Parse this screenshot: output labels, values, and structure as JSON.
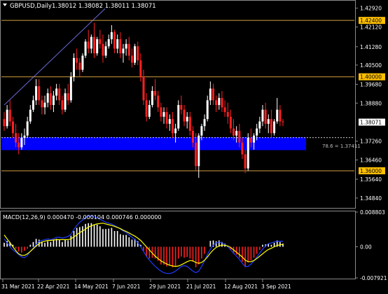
{
  "header": {
    "symbol_text": "GBPUSD,Daily",
    "ohlc_text": "1.38012 1.38082 1.38011 1.38071"
  },
  "colors": {
    "background": "#000000",
    "border": "#8a8a8a",
    "grid": "#2b2b2b",
    "axis_text": "#ffffff",
    "bull": "#ffffff",
    "bear": "#ff2020",
    "level_line": "#d4a040",
    "level_tag_bg": "#ffc000",
    "current_tag_bg": "#ffffff",
    "zone": "#0000ff",
    "trendline": "#6a6ad8",
    "fib_line": "#cccccc",
    "macd_hist_up": "#ffffff",
    "macd_hist_down": "#ff2020",
    "macd_signal": "#ffff00",
    "macd_line": "#1e3cff"
  },
  "price_axis": {
    "ticks": [
      "1.42920",
      "1.42120",
      "1.41280",
      "1.40500",
      "1.39680",
      "1.38880",
      "1.37260",
      "1.36460",
      "1.35640",
      "1.34840"
    ]
  },
  "levels": [
    {
      "value": "1.42400"
    },
    {
      "value": "1.40000"
    },
    {
      "value": "1.36000"
    }
  ],
  "current_price": "1.38071",
  "fib_label": "78.6 = 1.37411",
  "indicator": {
    "title": "MACD(12,26,9) 0.000470 -0.000104 0.000746 0.000000",
    "ticks": [
      "0.008803",
      "0.00",
      "-0.007921"
    ]
  },
  "time_axis": {
    "labels": [
      "31 Mar 2021",
      "22 Apr 2021",
      "14 May 2021",
      "7 Jun 2021",
      "29 Jun 2021",
      "21 Jul 2021",
      "12 Aug 2021",
      "3 Sep 2021"
    ]
  },
  "chart_data": {
    "type": "candlestick",
    "symbol": "GBPUSD",
    "timeframe": "Daily",
    "y_range": [
      1.3445,
      1.4315
    ],
    "candles": [
      [
        1.382,
        1.385,
        1.377,
        1.379
      ],
      [
        1.379,
        1.388,
        1.378,
        1.386
      ],
      [
        1.386,
        1.39,
        1.379,
        1.381
      ],
      [
        1.381,
        1.383,
        1.374,
        1.376
      ],
      [
        1.376,
        1.38,
        1.37,
        1.372
      ],
      [
        1.372,
        1.376,
        1.367,
        1.37
      ],
      [
        1.37,
        1.376,
        1.369,
        1.374
      ],
      [
        1.374,
        1.378,
        1.371,
        1.375
      ],
      [
        1.375,
        1.383,
        1.374,
        1.381
      ],
      [
        1.381,
        1.388,
        1.38,
        1.386
      ],
      [
        1.386,
        1.392,
        1.385,
        1.39
      ],
      [
        1.39,
        1.399,
        1.388,
        1.396
      ],
      [
        1.396,
        1.399,
        1.388,
        1.39
      ],
      [
        1.39,
        1.392,
        1.384,
        1.387
      ],
      [
        1.387,
        1.392,
        1.384,
        1.389
      ],
      [
        1.389,
        1.395,
        1.387,
        1.393
      ],
      [
        1.393,
        1.396,
        1.386,
        1.388
      ],
      [
        1.388,
        1.394,
        1.385,
        1.392
      ],
      [
        1.392,
        1.397,
        1.39,
        1.395
      ],
      [
        1.395,
        1.397,
        1.388,
        1.39
      ],
      [
        1.39,
        1.392,
        1.384,
        1.386
      ],
      [
        1.386,
        1.395,
        1.385,
        1.393
      ],
      [
        1.393,
        1.397,
        1.388,
        1.39
      ],
      [
        1.39,
        1.402,
        1.389,
        1.4
      ],
      [
        1.4,
        1.41,
        1.398,
        1.408
      ],
      [
        1.408,
        1.412,
        1.403,
        1.406
      ],
      [
        1.406,
        1.408,
        1.4,
        1.403
      ],
      [
        1.403,
        1.41,
        1.402,
        1.409
      ],
      [
        1.409,
        1.416,
        1.408,
        1.415
      ],
      [
        1.415,
        1.42,
        1.41,
        1.412
      ],
      [
        1.412,
        1.418,
        1.41,
        1.417
      ],
      [
        1.417,
        1.423,
        1.408,
        1.41
      ],
      [
        1.41,
        1.417,
        1.409,
        1.416
      ],
      [
        1.416,
        1.42,
        1.412,
        1.414
      ],
      [
        1.414,
        1.418,
        1.406,
        1.409
      ],
      [
        1.409,
        1.415,
        1.408,
        1.413
      ],
      [
        1.413,
        1.418,
        1.412,
        1.416
      ],
      [
        1.416,
        1.422,
        1.414,
        1.419
      ],
      [
        1.419,
        1.42,
        1.41,
        1.412
      ],
      [
        1.412,
        1.418,
        1.41,
        1.416
      ],
      [
        1.416,
        1.419,
        1.408,
        1.41
      ],
      [
        1.41,
        1.414,
        1.406,
        1.412
      ],
      [
        1.412,
        1.416,
        1.409,
        1.414
      ],
      [
        1.414,
        1.417,
        1.407,
        1.409
      ],
      [
        1.409,
        1.412,
        1.404,
        1.406
      ],
      [
        1.406,
        1.414,
        1.405,
        1.413
      ],
      [
        1.413,
        1.415,
        1.405,
        1.407
      ],
      [
        1.407,
        1.41,
        1.398,
        1.4
      ],
      [
        1.4,
        1.403,
        1.388,
        1.39
      ],
      [
        1.39,
        1.393,
        1.381,
        1.383
      ],
      [
        1.383,
        1.39,
        1.382,
        1.388
      ],
      [
        1.388,
        1.396,
        1.387,
        1.394
      ],
      [
        1.394,
        1.399,
        1.39,
        1.392
      ],
      [
        1.392,
        1.394,
        1.385,
        1.387
      ],
      [
        1.387,
        1.389,
        1.381,
        1.383
      ],
      [
        1.383,
        1.387,
        1.38,
        1.385
      ],
      [
        1.385,
        1.387,
        1.378,
        1.38
      ],
      [
        1.38,
        1.384,
        1.377,
        1.382
      ],
      [
        1.382,
        1.385,
        1.374,
        1.376
      ],
      [
        1.376,
        1.38,
        1.372,
        1.378
      ],
      [
        1.378,
        1.39,
        1.377,
        1.388
      ],
      [
        1.388,
        1.392,
        1.384,
        1.386
      ],
      [
        1.386,
        1.388,
        1.379,
        1.381
      ],
      [
        1.381,
        1.385,
        1.378,
        1.383
      ],
      [
        1.383,
        1.385,
        1.375,
        1.377
      ],
      [
        1.377,
        1.379,
        1.37,
        1.372
      ],
      [
        1.372,
        1.376,
        1.36,
        1.362
      ],
      [
        1.362,
        1.376,
        1.357,
        1.375
      ],
      [
        1.375,
        1.38,
        1.373,
        1.379
      ],
      [
        1.379,
        1.384,
        1.377,
        1.382
      ],
      [
        1.382,
        1.392,
        1.381,
        1.39
      ],
      [
        1.39,
        1.398,
        1.388,
        1.395
      ],
      [
        1.395,
        1.397,
        1.388,
        1.39
      ],
      [
        1.39,
        1.392,
        1.385,
        1.388
      ],
      [
        1.388,
        1.393,
        1.386,
        1.391
      ],
      [
        1.391,
        1.394,
        1.385,
        1.387
      ],
      [
        1.387,
        1.39,
        1.383,
        1.385
      ],
      [
        1.385,
        1.389,
        1.38,
        1.383
      ],
      [
        1.383,
        1.386,
        1.376,
        1.378
      ],
      [
        1.378,
        1.382,
        1.373,
        1.375
      ],
      [
        1.375,
        1.379,
        1.372,
        1.377
      ],
      [
        1.377,
        1.38,
        1.37,
        1.372
      ],
      [
        1.372,
        1.374,
        1.365,
        1.367
      ],
      [
        1.367,
        1.369,
        1.359,
        1.361
      ],
      [
        1.361,
        1.376,
        1.36,
        1.374
      ],
      [
        1.374,
        1.378,
        1.37,
        1.372
      ],
      [
        1.372,
        1.376,
        1.369,
        1.375
      ],
      [
        1.375,
        1.38,
        1.373,
        1.378
      ],
      [
        1.378,
        1.383,
        1.376,
        1.381
      ],
      [
        1.381,
        1.388,
        1.379,
        1.386
      ],
      [
        1.386,
        1.389,
        1.378,
        1.38
      ],
      [
        1.38,
        1.384,
        1.376,
        1.382
      ],
      [
        1.382,
        1.386,
        1.374,
        1.376
      ],
      [
        1.376,
        1.382,
        1.375,
        1.381
      ],
      [
        1.381,
        1.391,
        1.38,
        1.386
      ],
      [
        1.386,
        1.388,
        1.379,
        1.381
      ],
      [
        1.381,
        1.382,
        1.379,
        1.3807
      ]
    ],
    "macd_histogram": [
      0.001,
      0.0015,
      0.0012,
      0.0005,
      -0.0005,
      -0.0012,
      -0.0015,
      -0.001,
      -0.0005,
      0.0005,
      0.0012,
      0.002,
      0.0018,
      0.0012,
      0.001,
      0.0014,
      0.0012,
      0.0016,
      0.002,
      0.0018,
      0.0012,
      0.0018,
      0.0016,
      0.0028,
      0.004,
      0.0048,
      0.005,
      0.0052,
      0.0058,
      0.006,
      0.006,
      0.0055,
      0.0056,
      0.0052,
      0.0045,
      0.0045,
      0.0046,
      0.0048,
      0.004,
      0.004,
      0.0032,
      0.003,
      0.003,
      0.0024,
      0.0018,
      0.002,
      0.0014,
      0.0005,
      -0.001,
      -0.0025,
      -0.003,
      -0.0028,
      -0.003,
      -0.0036,
      -0.0045,
      -0.0046,
      -0.005,
      -0.0048,
      -0.0052,
      -0.005,
      -0.003,
      -0.0025,
      -0.0028,
      -0.0026,
      -0.003,
      -0.0038,
      -0.0052,
      -0.0045,
      -0.003,
      -0.0018,
      0.0,
      0.0015,
      0.0016,
      0.0014,
      0.0016,
      0.0012,
      0.0008,
      0.0002,
      -0.0008,
      -0.0018,
      -0.002,
      -0.0028,
      -0.0038,
      -0.0052,
      -0.004,
      -0.0035,
      -0.0028,
      -0.0018,
      -0.0008,
      0.0005,
      0.0006,
      0.0008,
      0.0005,
      0.001,
      0.0016,
      0.0012,
      0.0008
    ],
    "macd_signal": [
      0.003,
      0.002,
      0.001,
      0.0,
      -0.001,
      -0.0018,
      -0.0022,
      -0.0022,
      -0.0018,
      -0.0012,
      -0.0005,
      0.0002,
      0.0008,
      0.0012,
      0.0014,
      0.0016,
      0.0016,
      0.0017,
      0.0018,
      0.0018,
      0.0018,
      0.0018,
      0.0018,
      0.002,
      0.0025,
      0.003,
      0.0036,
      0.004,
      0.0045,
      0.005,
      0.0053,
      0.0056,
      0.0058,
      0.0059,
      0.006,
      0.0058,
      0.0056,
      0.0054,
      0.0052,
      0.0049,
      0.0046,
      0.0042,
      0.0039,
      0.0035,
      0.0031,
      0.0027,
      0.0022,
      0.0016,
      0.0008,
      0.0,
      -0.0008,
      -0.0016,
      -0.0024,
      -0.003,
      -0.0036,
      -0.004,
      -0.0044,
      -0.0047,
      -0.0049,
      -0.005,
      -0.0049,
      -0.0046,
      -0.0042,
      -0.0038,
      -0.0035,
      -0.0036,
      -0.004,
      -0.0042,
      -0.004,
      -0.0034,
      -0.0026,
      -0.0016,
      -0.0008,
      -0.0002,
      0.0002,
      0.0004,
      0.0004,
      0.0002,
      -0.0002,
      -0.0008,
      -0.0014,
      -0.002,
      -0.0026,
      -0.0034,
      -0.0038,
      -0.0038,
      -0.0035,
      -0.003,
      -0.0024,
      -0.0018,
      -0.0012,
      -0.0007,
      -0.0004,
      0.0,
      0.0003,
      0.0005,
      0.0006
    ],
    "macd_line": [
      0.002,
      0.001,
      0.0,
      -0.0008,
      -0.0014,
      -0.002,
      -0.0026,
      -0.0028,
      -0.0022,
      -0.0012,
      -0.0004,
      0.0006,
      0.0014,
      0.0016,
      0.0018,
      0.002,
      0.0018,
      0.002,
      0.0024,
      0.0024,
      0.0022,
      0.0024,
      0.0026,
      0.0032,
      0.0044,
      0.0054,
      0.0062,
      0.0068,
      0.0074,
      0.0078,
      0.0078,
      0.0076,
      0.0074,
      0.007,
      0.0066,
      0.0062,
      0.006,
      0.0058,
      0.0054,
      0.005,
      0.0045,
      0.004,
      0.0036,
      0.003,
      0.0024,
      0.0018,
      0.001,
      0.0,
      -0.0012,
      -0.0024,
      -0.0034,
      -0.0042,
      -0.005,
      -0.0056,
      -0.0062,
      -0.0066,
      -0.0068,
      -0.0068,
      -0.0066,
      -0.0062,
      -0.0056,
      -0.005,
      -0.0048,
      -0.005,
      -0.0056,
      -0.0062,
      -0.0066,
      -0.0062,
      -0.005,
      -0.0036,
      -0.002,
      -0.0006,
      0.0004,
      0.001,
      0.0012,
      0.001,
      0.0006,
      0.0,
      -0.0008,
      -0.0016,
      -0.0024,
      -0.0032,
      -0.0042,
      -0.005,
      -0.005,
      -0.0044,
      -0.0036,
      -0.0026,
      -0.0016,
      -0.0006,
      0.0002,
      0.0008,
      0.001,
      0.0012,
      0.0014,
      0.0014,
      0.0014
    ],
    "macd_range": [
      -0.007921,
      0.008803
    ]
  }
}
